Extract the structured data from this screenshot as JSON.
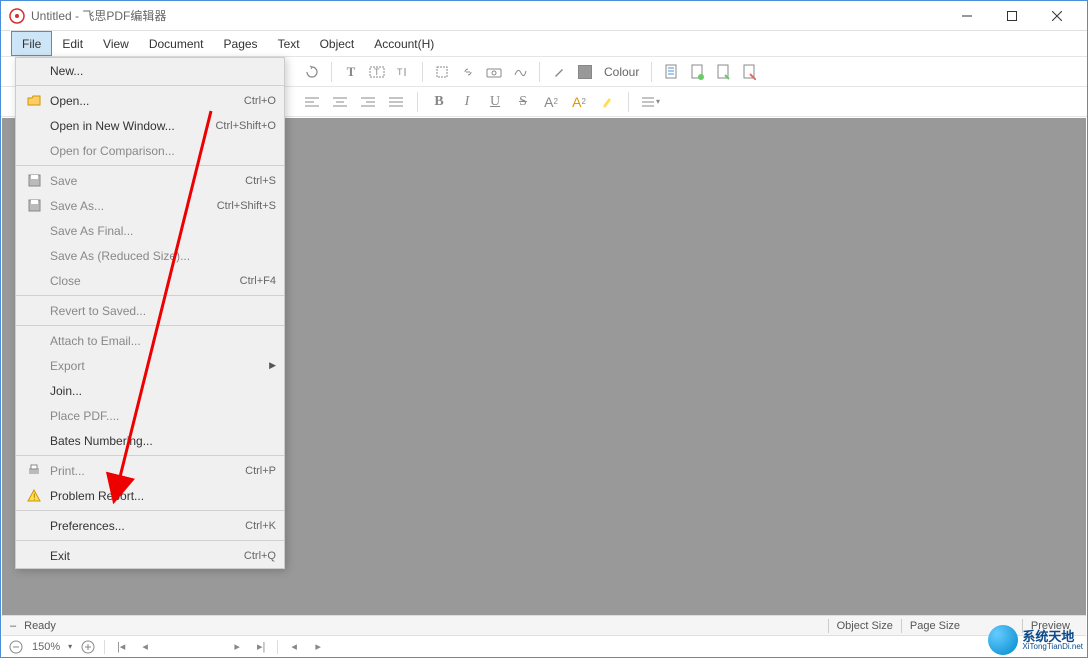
{
  "window": {
    "title": "Untitled - 飞思PDF编辑器"
  },
  "menubar": [
    "File",
    "Edit",
    "View",
    "Document",
    "Pages",
    "Text",
    "Object",
    "Account(H)"
  ],
  "toolbar": {
    "color_label": "Colour"
  },
  "format": {
    "bold": "B",
    "italic": "I",
    "underline": "U",
    "strike": "S",
    "super": "A",
    "sub": "A"
  },
  "file_menu": {
    "items": [
      {
        "label": "New...",
        "shortcut": "",
        "icon": "",
        "type": "item"
      },
      {
        "type": "sep"
      },
      {
        "label": "Open...",
        "shortcut": "Ctrl+O",
        "icon": "open",
        "type": "item"
      },
      {
        "label": "Open in New Window...",
        "shortcut": "Ctrl+Shift+O",
        "icon": "",
        "type": "item"
      },
      {
        "label": "Open for Comparison...",
        "shortcut": "",
        "icon": "",
        "type": "item",
        "disabled": true
      },
      {
        "type": "sep"
      },
      {
        "label": "Save",
        "shortcut": "Ctrl+S",
        "icon": "save",
        "type": "item",
        "disabled": true
      },
      {
        "label": "Save As...",
        "shortcut": "Ctrl+Shift+S",
        "icon": "saveas",
        "type": "item",
        "disabled": true
      },
      {
        "label": "Save As Final...",
        "shortcut": "",
        "icon": "",
        "type": "item",
        "disabled": true
      },
      {
        "label": "Save As (Reduced Size)...",
        "shortcut": "",
        "icon": "",
        "type": "item",
        "disabled": true
      },
      {
        "label": "Close",
        "shortcut": "Ctrl+F4",
        "icon": "",
        "type": "item",
        "disabled": true
      },
      {
        "type": "sep"
      },
      {
        "label": "Revert to Saved...",
        "shortcut": "",
        "icon": "",
        "type": "item",
        "disabled": true
      },
      {
        "type": "sep"
      },
      {
        "label": "Attach to Email...",
        "shortcut": "",
        "icon": "",
        "type": "item",
        "disabled": true
      },
      {
        "label": "Export",
        "shortcut": "",
        "icon": "",
        "type": "submenu",
        "disabled": true
      },
      {
        "label": "Join...",
        "shortcut": "",
        "icon": "",
        "type": "item"
      },
      {
        "label": "Place PDF....",
        "shortcut": "",
        "icon": "",
        "type": "item",
        "disabled": true
      },
      {
        "label": "Bates Numbering...",
        "shortcut": "",
        "icon": "",
        "type": "item"
      },
      {
        "type": "sep"
      },
      {
        "label": "Print...",
        "shortcut": "Ctrl+P",
        "icon": "print",
        "type": "item",
        "disabled": true
      },
      {
        "label": "Problem Report...",
        "shortcut": "",
        "icon": "warn",
        "type": "item"
      },
      {
        "type": "sep"
      },
      {
        "label": "Preferences...",
        "shortcut": "Ctrl+K",
        "icon": "",
        "type": "item",
        "highlight": true
      },
      {
        "type": "sep"
      },
      {
        "label": "Exit",
        "shortcut": "Ctrl+Q",
        "icon": "",
        "type": "item"
      }
    ]
  },
  "statusbar": {
    "ready": "Ready",
    "object_size": "Object Size",
    "page_size": "Page Size",
    "preview": "Preview"
  },
  "bottombar": {
    "zoom": "150%"
  },
  "watermark": {
    "cn": "系统天地",
    "en": "XiTongTianDi.net"
  }
}
